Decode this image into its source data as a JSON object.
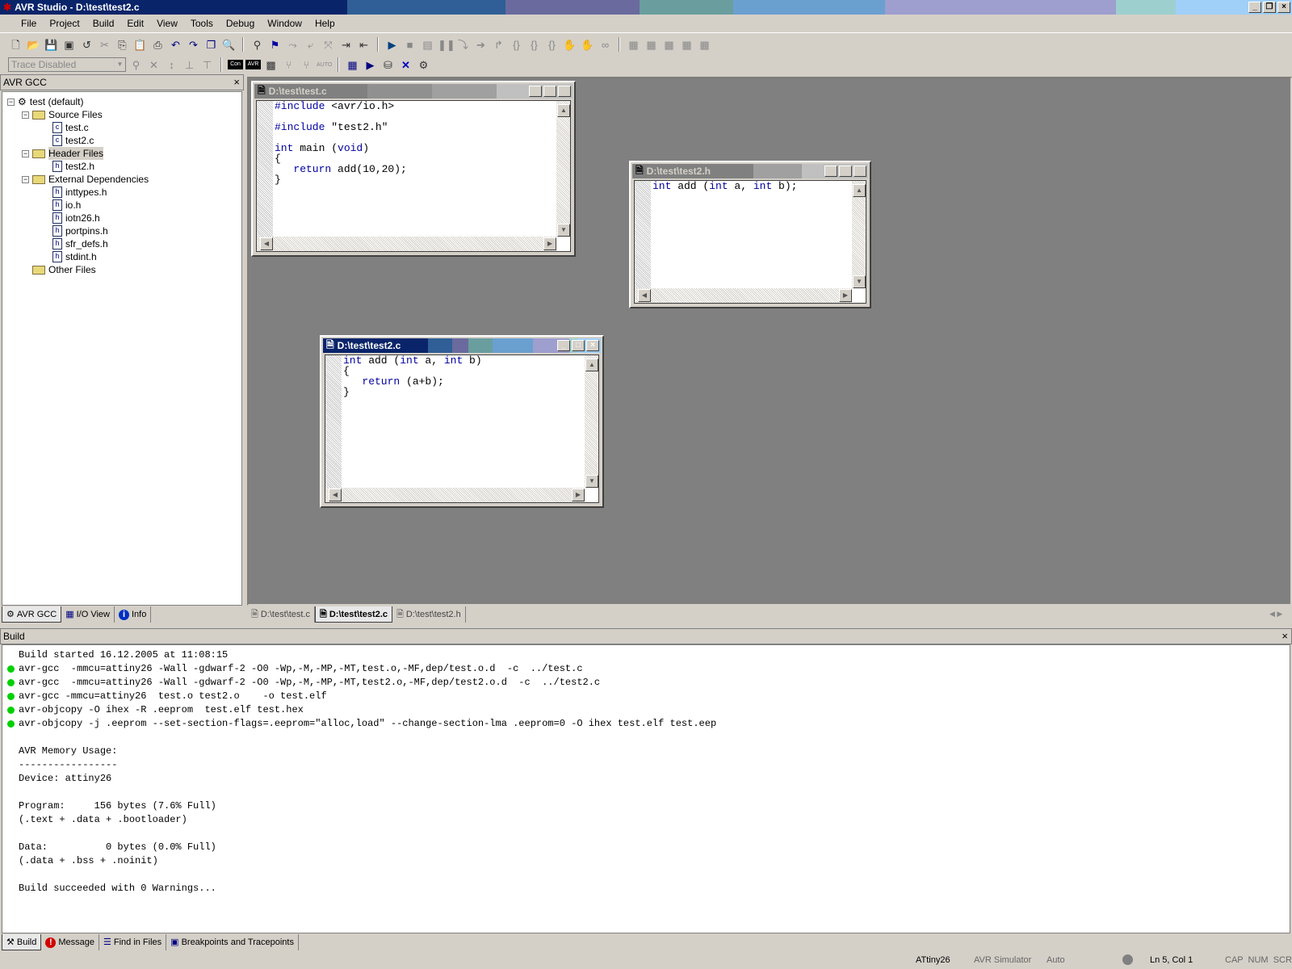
{
  "window": {
    "title": "AVR Studio - D:\\test\\test2.c",
    "minimize": "_",
    "maximize": "❐",
    "close": "×"
  },
  "menu": [
    "File",
    "Project",
    "Build",
    "Edit",
    "View",
    "Tools",
    "Debug",
    "Window",
    "Help"
  ],
  "toolbar": {
    "trace_select": "Trace Disabled"
  },
  "left_panel": {
    "title": "AVR GCC",
    "close": "×",
    "tree": {
      "root": "test (default)",
      "source_folder": "Source Files",
      "sources": [
        "test.c",
        "test2.c"
      ],
      "header_folder": "Header Files",
      "headers": [
        "test2.h"
      ],
      "ext_folder": "External Dependencies",
      "ext": [
        "inttypes.h",
        "io.h",
        "iotn26.h",
        "portpins.h",
        "sfr_defs.h",
        "stdint.h"
      ],
      "other_folder": "Other Files"
    },
    "tabs": [
      "AVR GCC",
      "I/O View",
      "Info"
    ]
  },
  "editors": {
    "test_c": {
      "title": "D:\\test\\test.c",
      "lines": [
        [
          "kw",
          "#include",
          " <avr/io.h>"
        ],
        [
          "",
          ""
        ],
        [
          "kw",
          "#include",
          " \"test2.h\""
        ],
        [
          "",
          ""
        ],
        [
          "kw",
          "int",
          " main (",
          "void",
          ")"
        ],
        [
          "",
          "{"
        ],
        [
          "",
          "   ",
          "return",
          " add(10,20);"
        ],
        [
          "",
          "}"
        ]
      ]
    },
    "test2_h": {
      "title": "D:\\test\\test2.h"
    },
    "test2_c": {
      "title": "D:\\test\\test2.c"
    }
  },
  "doc_tabs": [
    "D:\\test\\test.c",
    "D:\\test\\test2.c",
    "D:\\test\\test2.h"
  ],
  "build": {
    "title": "Build",
    "close": "×",
    "lines": [
      {
        "ok": false,
        "text": "Build started 16.12.2005 at 11:08:15"
      },
      {
        "ok": true,
        "text": "avr-gcc  -mmcu=attiny26 -Wall -gdwarf-2 -O0 -Wp,-M,-MP,-MT,test.o,-MF,dep/test.o.d  -c  ../test.c"
      },
      {
        "ok": true,
        "text": "avr-gcc  -mmcu=attiny26 -Wall -gdwarf-2 -O0 -Wp,-M,-MP,-MT,test2.o,-MF,dep/test2.o.d  -c  ../test2.c"
      },
      {
        "ok": true,
        "text": "avr-gcc -mmcu=attiny26  test.o test2.o    -o test.elf"
      },
      {
        "ok": true,
        "text": "avr-objcopy -O ihex -R .eeprom  test.elf test.hex"
      },
      {
        "ok": true,
        "text": "avr-objcopy -j .eeprom --set-section-flags=.eeprom=\"alloc,load\" --change-section-lma .eeprom=0 -O ihex test.elf test.eep"
      },
      {
        "ok": false,
        "text": ""
      },
      {
        "ok": false,
        "text": "AVR Memory Usage:"
      },
      {
        "ok": false,
        "text": "-----------------"
      },
      {
        "ok": false,
        "text": "Device: attiny26"
      },
      {
        "ok": false,
        "text": ""
      },
      {
        "ok": false,
        "text": "Program:     156 bytes (7.6% Full)"
      },
      {
        "ok": false,
        "text": "(.text + .data + .bootloader)"
      },
      {
        "ok": false,
        "text": ""
      },
      {
        "ok": false,
        "text": "Data:          0 bytes (0.0% Full)"
      },
      {
        "ok": false,
        "text": "(.data + .bss + .noinit)"
      },
      {
        "ok": false,
        "text": ""
      },
      {
        "ok": false,
        "text": "Build succeeded with 0 Warnings..."
      }
    ],
    "tabs": [
      "Build",
      "Message",
      "Find in Files",
      "Breakpoints and Tracepoints"
    ]
  },
  "status": {
    "device": "ATtiny26",
    "platform": "AVR Simulator",
    "mode": "Auto",
    "position": "Ln 5, Col 1",
    "keys": "CAP  NUM  SCRL"
  }
}
